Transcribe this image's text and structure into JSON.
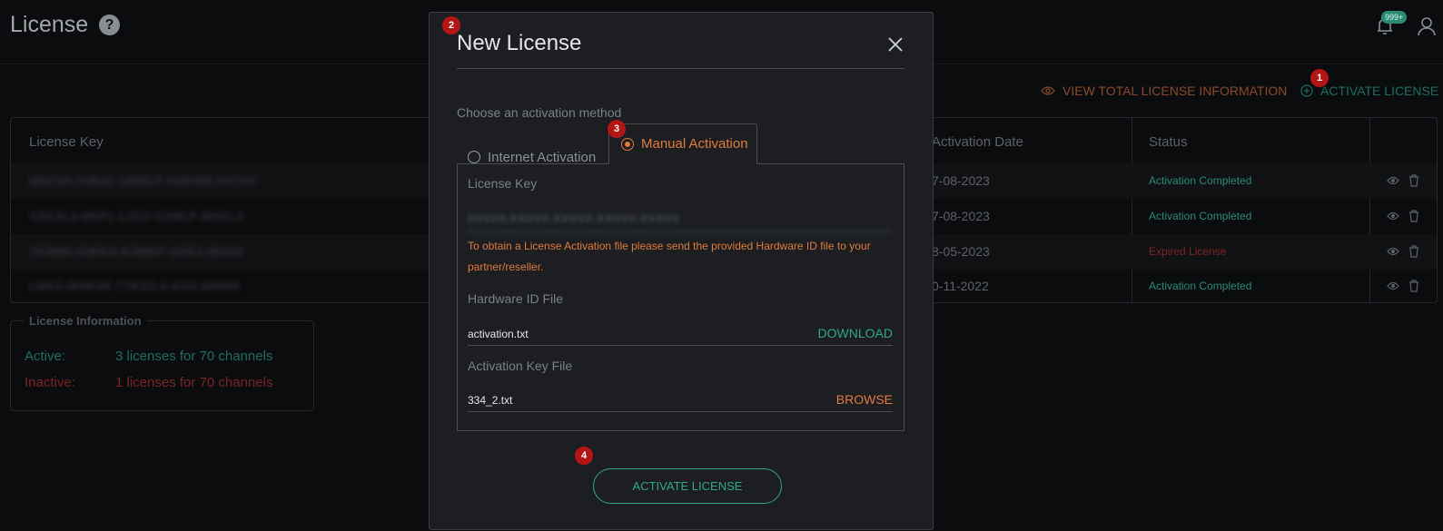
{
  "header": {
    "title": "License",
    "help_glyph": "?",
    "notification_count": "999+"
  },
  "toolbar": {
    "view_total_label": "VIEW TOTAL LICENSE INFORMATION",
    "activate_label": "ACTIVATE LICENSE"
  },
  "table": {
    "col_key": "License Key",
    "col_activation": "Activation Date",
    "col_status": "Status",
    "rows": [
      {
        "key": "MXC4X-X3KKL-HNKLF-XXKXM-XX7XX",
        "date": "7-08-2023",
        "status": "Activation Completed",
        "state": "ok"
      },
      {
        "key": "XXKXL4-MXFL-L3XX-XXMLF-MXKLX",
        "date": "7-08-2023",
        "status": "Activation Completed",
        "state": "ok"
      },
      {
        "key": "7XXMX-X3KKX-KXMXF-XXKX-MXXX",
        "date": "8-05-2023",
        "status": "Expired License",
        "state": "expired"
      },
      {
        "key": "LMKX-MXKXF-7YKX3-X-KXX-MXMX",
        "date": "0-11-2022",
        "status": "Activation Completed",
        "state": "ok"
      }
    ]
  },
  "license_info": {
    "legend": "License Information",
    "active_label": "Active:",
    "active_value": "3 licenses for 70 channels",
    "inactive_label": "Inactive:",
    "inactive_value": "1 licenses for 70 channels"
  },
  "modal": {
    "title": "New License",
    "choose_label": "Choose an activation method",
    "tab_internet": "Internet Activation",
    "tab_manual": "Manual Activation",
    "license_key_label": "License Key",
    "license_key_value": "XXXXX-XXXXX-XXXXX-XXXXX-XXXXX",
    "hint": "To obtain a License Activation file please send the provided Hardware ID file to your partner/reseller.",
    "hardware_label": "Hardware ID File",
    "hardware_file": "activation.txt",
    "download_label": "DOWNLOAD",
    "activation_file_label": "Activation Key File",
    "activation_file": "334_2.txt",
    "browse_label": "BROWSE",
    "activate_button": "ACTIVATE LICENSE"
  },
  "steps": [
    "1",
    "2",
    "3",
    "4"
  ],
  "colors": {
    "accent_green": "#2fa88a",
    "accent_orange": "#e07b3c",
    "expired_red": "#7b2424",
    "step_badge": "#b41515"
  }
}
